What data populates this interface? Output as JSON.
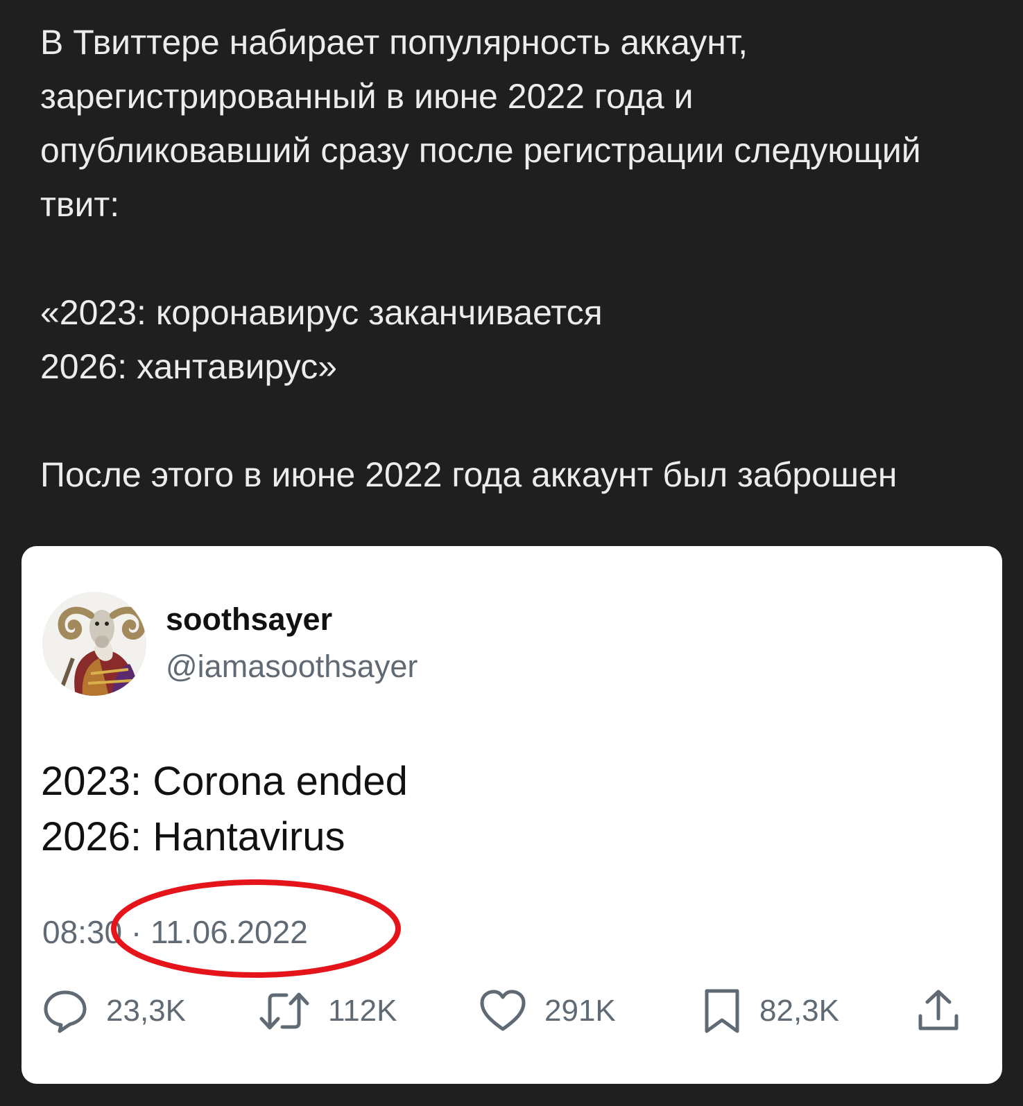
{
  "post": {
    "lines": [
      "В Твиттере набирает популярность аккаунт,",
      "зарегистрированный в июне 2022 года и",
      "опубликовавший сразу после регистрации следующий",
      "твит:",
      "«2023: коронавирус заканчивается",
      "2026: хантавирус»",
      "После этого в июне 2022 года аккаунт был заброшен"
    ]
  },
  "tweet": {
    "display_name": "soothsayer",
    "handle": "@iamasoothsayer",
    "body_lines": [
      "2023: Corona ended",
      "2026: Hantavirus"
    ],
    "timestamp": "08:30 · 11.06.2022",
    "actions": {
      "replies": "23,3K",
      "retweets": "112K",
      "likes": "291K",
      "bookmarks": "82,3K"
    },
    "highlight_color": "#e5141b"
  },
  "icons": {
    "reply": "reply-icon",
    "retweet": "retweet-icon",
    "like": "heart-icon",
    "bookmark": "bookmark-icon",
    "share": "share-icon"
  }
}
